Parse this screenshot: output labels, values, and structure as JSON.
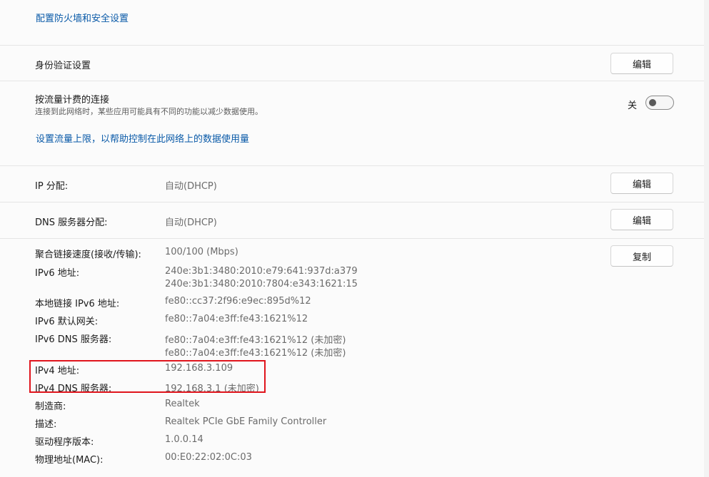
{
  "top": {
    "firewall_link": "配置防火墙和安全设置"
  },
  "auth": {
    "label": "身份验证设置",
    "button": "编辑"
  },
  "metered": {
    "label": "按流量计费的连接",
    "description": "连接到此网络时，某些应用可能具有不同的功能以减少数据使用。",
    "toggle_state": "关",
    "toggle_on": false,
    "limit_link": "设置流量上限，以帮助控制在此网络上的数据使用量"
  },
  "ip": {
    "label": "IP 分配:",
    "value": "自动(DHCP)",
    "button": "编辑"
  },
  "dns": {
    "label": "DNS 服务器分配:",
    "value": "自动(DHCP)",
    "button": "编辑"
  },
  "props": {
    "copy_button": "复制",
    "rows": [
      {
        "label": "聚合链接速度(接收/传输):",
        "values": [
          "100/100 (Mbps)"
        ]
      },
      {
        "label": "IPv6 地址:",
        "values": [
          "240e:3b1:3480:2010:e79:641:937d:a379",
          "240e:3b1:3480:2010:7804:e343:1621:15"
        ]
      },
      {
        "label": "本地链接 IPv6 地址:",
        "values": [
          "fe80::cc37:2f96:e9ec:895d%12"
        ]
      },
      {
        "label": "IPv6 默认网关:",
        "values": [
          "fe80::7a04:e3ff:fe43:1621%12"
        ]
      },
      {
        "label": "IPv6 DNS 服务器:",
        "values": [
          "fe80::7a04:e3ff:fe43:1621%12 (未加密)",
          "fe80::7a04:e3ff:fe43:1621%12 (未加密)"
        ]
      },
      {
        "label": "IPv4 地址:",
        "values": [
          "192.168.3.109"
        ]
      },
      {
        "label": "IPv4 DNS 服务器:",
        "values": [
          "192.168.3.1 (未加密)"
        ]
      },
      {
        "label": "制造商:",
        "values": [
          "Realtek"
        ]
      },
      {
        "label": "描述:",
        "values": [
          "Realtek PCIe GbE Family Controller"
        ]
      },
      {
        "label": "驱动程序版本:",
        "values": [
          "1.0.0.14"
        ]
      },
      {
        "label": "物理地址(MAC):",
        "values": [
          "00:E0:22:02:0C:03"
        ]
      }
    ]
  },
  "colors": {
    "accent": "#0a5aa8",
    "highlight": "#e0141c"
  }
}
